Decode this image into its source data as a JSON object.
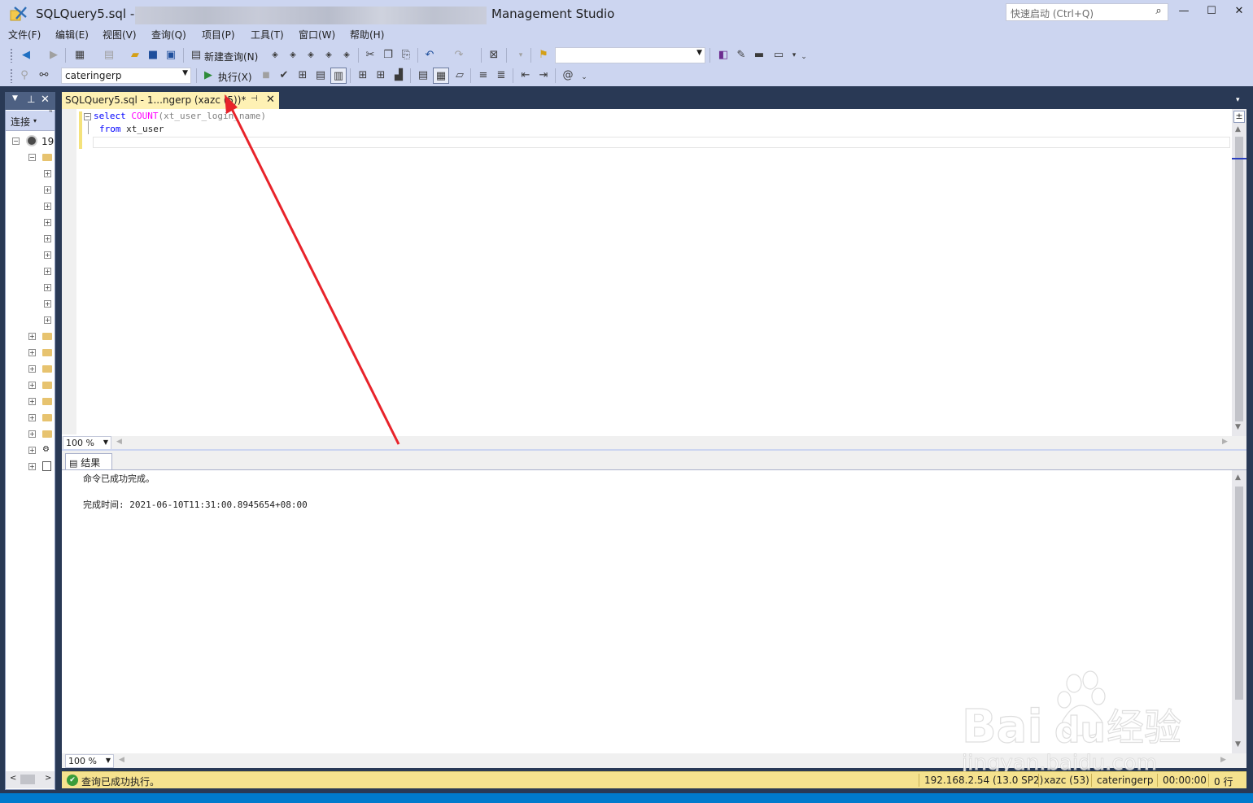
{
  "window": {
    "title_left": "SQLQuery5.sql -",
    "title_right": "Management Studio",
    "quick_launch_placeholder": "快速启动 (Ctrl+Q)",
    "controls": [
      "—",
      "☐",
      "✕"
    ]
  },
  "menu": [
    "文件(F)",
    "编辑(E)",
    "视图(V)",
    "查询(Q)",
    "项目(P)",
    "工具(T)",
    "窗口(W)",
    "帮助(H)"
  ],
  "toolbar1": {
    "new_query_label": "新建查询(N)",
    "icons": [
      "back-icon",
      "forward-icon",
      "new-project-icon",
      "add-item-icon",
      "open-file-icon",
      "save-icon",
      "save-all-icon",
      "mdx-query-icon",
      "dmx-query-icon",
      "xmla-query-icon",
      "dax-query-icon",
      "cut-icon",
      "copy-icon",
      "paste-icon",
      "undo-icon",
      "redo-icon",
      "activity-monitor-icon",
      "find-icon",
      "solution-explorer-icon",
      "properties-icon",
      "toolbox-icon",
      "console-icon"
    ],
    "search_value": ""
  },
  "toolbar2": {
    "database": "cateringerp",
    "execute_label": "执行(X)"
  },
  "object_explorer": {
    "connect_label": "连接",
    "server_prefix": "19"
  },
  "document_tab": {
    "label": "SQLQuery5.sql - 1...ngerp (xazc (5",
    "label_tail": "))*"
  },
  "editor": {
    "line1_kw": "select",
    "line1_fn": "COUNT",
    "line1_rest": "(xt_user_login_name)",
    "line2_kw": "from",
    "line2_rest": "xt_user",
    "zoom": "100 %"
  },
  "results": {
    "tab_label": "结果",
    "message": "命令已成功完成。",
    "completion_label": "完成时间: 2021-06-10T11:31:00.8945654+08:00",
    "zoom": "100 %"
  },
  "status": {
    "message": "查询已成功执行。",
    "server": "192.168.2.54 (13.0 SP2)",
    "user": "xazc (53)",
    "database": "cateringerp",
    "elapsed": "00:00:00",
    "rows": "0 行"
  },
  "watermark": {
    "brand": "Bai",
    "brand2": "du",
    "brand_cn": "经验",
    "url": "jingyan.baidu.com"
  },
  "colors": {
    "chrome": "#ccd5f0",
    "dark": "#293955",
    "active_tab": "#fef1b4",
    "status": "#f5e28e",
    "keyword": "#0000ff",
    "function": "#ff00ff",
    "arrow": "#e8232a",
    "accent": "#007acc"
  }
}
